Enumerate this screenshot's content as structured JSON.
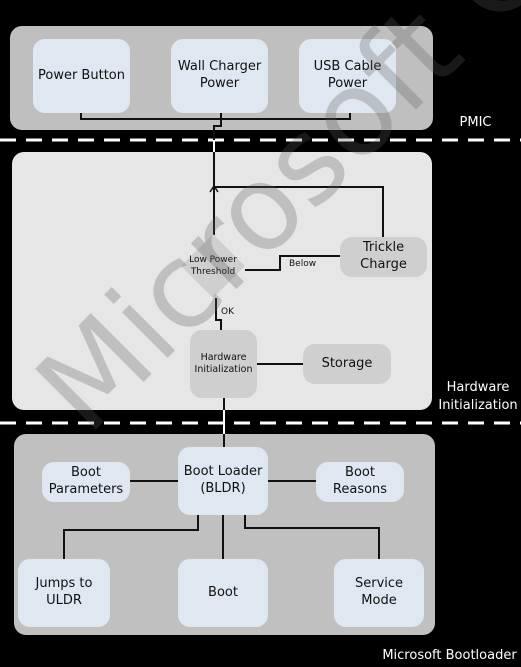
{
  "pmic": {
    "label": "PMIC",
    "boxes": [
      "Power Button",
      "Wall Charger\nPower",
      "USB Cable\nPower"
    ]
  },
  "hardware": {
    "label": "Hardware\nInitialization",
    "low_power": "Low Power\nThreshold",
    "trickle": "Trickle\nCharge",
    "below": "Below",
    "ok": "OK",
    "hw_init": "Hardware\nInitialization",
    "storage": "Storage"
  },
  "bootloader": {
    "label": "Microsoft Bootloader",
    "bldr": "Boot Loader\n(BLDR)",
    "params": "Boot\nParameters",
    "reasons": "Boot\nReasons",
    "jumps": "Jumps to\nULDR",
    "boot": "Boot",
    "service": "Service\nMode"
  },
  "watermark": "Microsoft Confidential",
  "colors": {
    "background": "#000000",
    "box": "#dfe8f0",
    "panel_mid": "#e6e6e6",
    "panel": "#bfbfbf"
  }
}
